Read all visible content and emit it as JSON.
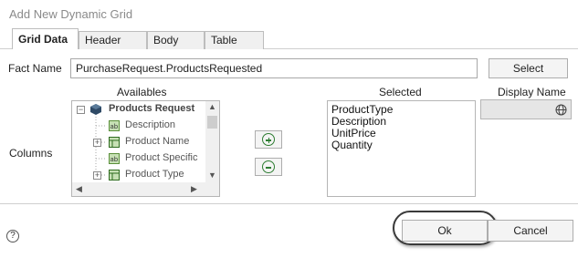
{
  "window": {
    "title": "Add New Dynamic Grid"
  },
  "tabs": [
    {
      "label": "Grid Data",
      "active": true
    },
    {
      "label": "Header Style",
      "active": false
    },
    {
      "label": "Body Style",
      "active": false
    },
    {
      "label": "Table Style",
      "active": false
    }
  ],
  "fact": {
    "label": "Fact Name",
    "value": "PurchaseRequest.ProductsRequested",
    "select_label": "Select"
  },
  "columns": {
    "label": "Columns",
    "availables_header": "Availables",
    "selected_header": "Selected",
    "display_name_header": "Display Name",
    "tree": [
      {
        "label": "Products Request",
        "icon": "cube-icon",
        "expander": "minus"
      },
      {
        "label": "Description",
        "icon": "text-field-icon",
        "expander": ""
      },
      {
        "label": "Product Name",
        "icon": "table-icon",
        "expander": "plus"
      },
      {
        "label": "Product Specific",
        "icon": "text-field-icon",
        "expander": ""
      },
      {
        "label": "Product Type",
        "icon": "table-icon",
        "expander": "plus"
      }
    ],
    "selected": [
      "ProductType",
      "Description",
      "UnitPrice",
      "Quantity"
    ]
  },
  "buttons": {
    "ok": "Ok",
    "cancel": "Cancel",
    "help": "?"
  },
  "colors": {
    "accent_green": "#2e7d32",
    "tree_icon_green": "#c6e0b4",
    "border": "#adadad"
  }
}
